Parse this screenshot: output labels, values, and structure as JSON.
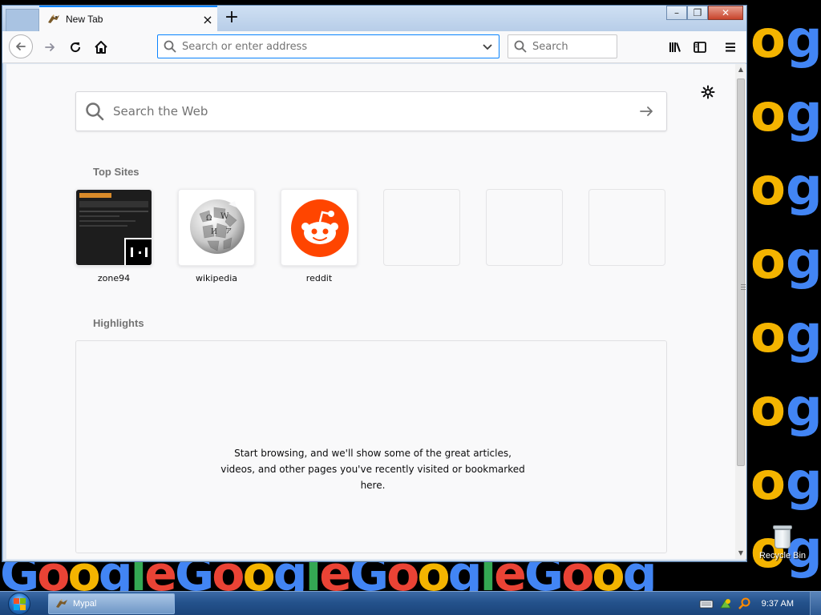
{
  "browser": {
    "tab_title": "New Tab",
    "close_tab_glyph": "×",
    "new_tab_glyph": "+",
    "window_buttons": [
      "minimize",
      "restore",
      "close"
    ]
  },
  "toolbar": {
    "address_placeholder": "Search or enter address",
    "search_placeholder": "Search"
  },
  "newtab": {
    "web_search_placeholder": "Search the Web",
    "top_sites_title": "Top Sites",
    "top_sites": [
      {
        "label": "zone94",
        "icon": "zone94-thumbnail"
      },
      {
        "label": "wikipedia",
        "icon": "wikipedia-globe-icon"
      },
      {
        "label": "reddit",
        "icon": "reddit-alien-icon"
      },
      {
        "label": "",
        "icon": "empty"
      },
      {
        "label": "",
        "icon": "empty"
      },
      {
        "label": "",
        "icon": "empty"
      }
    ],
    "highlights_title": "Highlights",
    "highlights_empty_message": "Start browsing, and we'll show some of the great articles, videos, and other pages you've recently visited or bookmarked here."
  },
  "desktop": {
    "recycle_bin_label": "Recycle Bin"
  },
  "taskbar": {
    "app_label": "Mypal",
    "clock": "9:37 AM"
  },
  "colors": {
    "accent": "#0a84ff",
    "reddit": "#ff4500",
    "google_blue": "#4285f4",
    "google_red": "#ea4335",
    "google_yellow": "#f4b400",
    "google_green": "#34a853"
  }
}
